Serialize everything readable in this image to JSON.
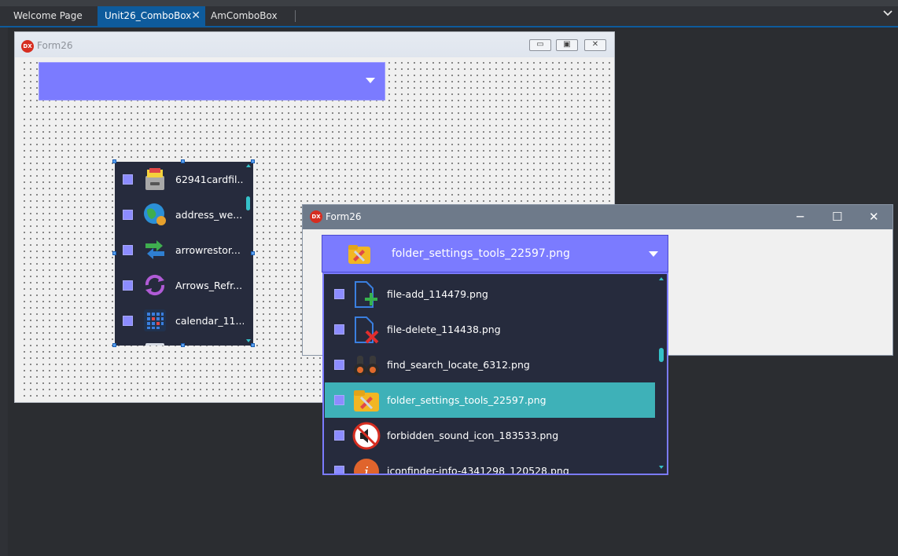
{
  "ide": {
    "tabs": [
      {
        "label": "Welcome Page"
      },
      {
        "label": "Unit26_ComboBox",
        "close_icon": "close-icon"
      },
      {
        "label": "AmComboBox"
      }
    ],
    "tab_menu_icon": "chevron-down-icon",
    "accent_color": "#0e5b9c"
  },
  "design_form": {
    "title": "Form26",
    "logo_text": "DX",
    "buttons": {
      "minimize": "minimize-icon",
      "restore": "restore-icon",
      "close": "close-icon"
    },
    "combo": {
      "selected_text": "",
      "background": "#7b7bff",
      "arrow_icon": "triangle-down-icon"
    },
    "list_items": [
      {
        "label": "62941cardfil...",
        "icon": "card-file-icon"
      },
      {
        "label": "address_we...",
        "icon": "globe-icon"
      },
      {
        "label": "arrowrestor...",
        "icon": "arrow-restore-icon"
      },
      {
        "label": "Arrows_Refr...",
        "icon": "refresh-icon"
      },
      {
        "label": "calendar_11...",
        "icon": "calendar-icon"
      }
    ]
  },
  "runtime_form": {
    "title": "Form26",
    "logo_text": "DX",
    "controls": {
      "minimize": "─",
      "maximize": "☐",
      "close": "✕"
    },
    "combo": {
      "selected_text": "folder_settings_tools_22597.png",
      "selected_icon": "folder-settings-icon",
      "background": "#7b7bff"
    },
    "list_items": [
      {
        "label": "file-add_114479.png",
        "icon": "file-add-icon",
        "selected": false
      },
      {
        "label": "file-delete_114438.png",
        "icon": "file-delete-icon",
        "selected": false
      },
      {
        "label": "find_search_locate_6312.png",
        "icon": "binoculars-icon",
        "selected": false
      },
      {
        "label": "folder_settings_tools_22597.png",
        "icon": "folder-settings-icon",
        "selected": true
      },
      {
        "label": "forbidden_sound_icon_183533.png",
        "icon": "mute-icon",
        "selected": false
      },
      {
        "label": "iconfinder-info-4341298_120528.png",
        "icon": "info-icon",
        "selected": false
      }
    ],
    "selection_color": "#3eb1b8",
    "list_background": "#262b3d"
  }
}
